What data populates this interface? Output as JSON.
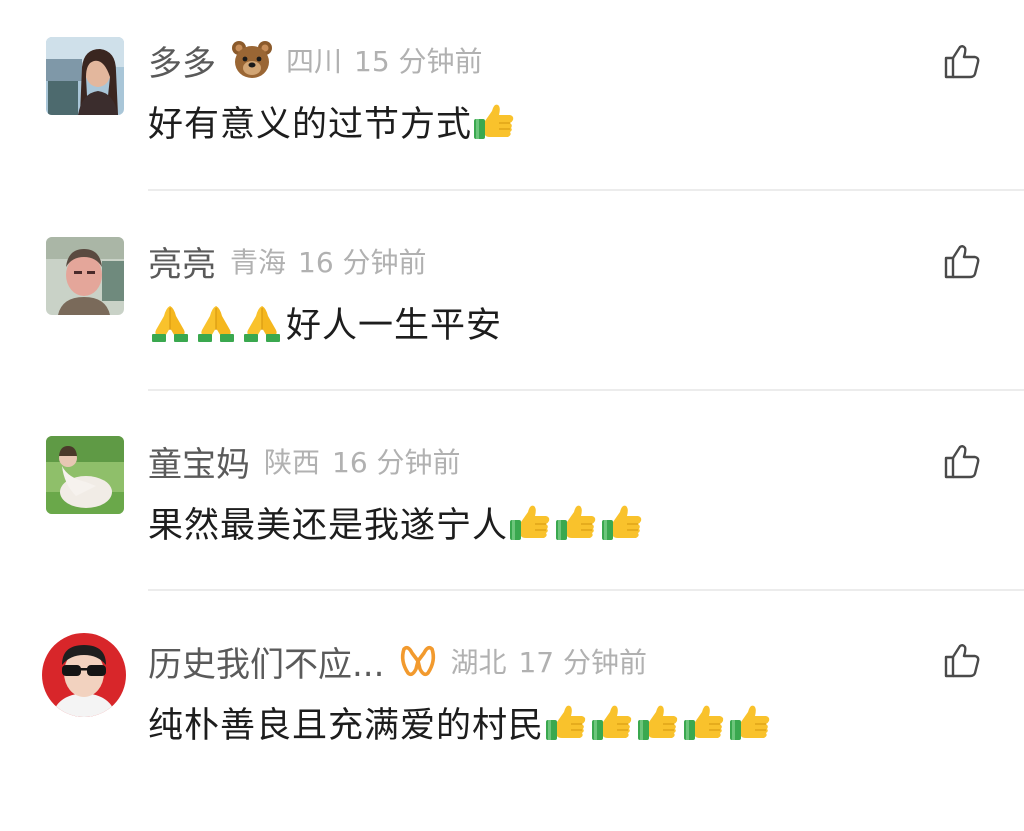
{
  "colors": {
    "username": "#5a5a5a",
    "meta": "#b1b1b1",
    "text": "#1d1d1d",
    "divider": "#ececec",
    "like_icon": "#4a4a4a",
    "emoji_yellow": "#f9c22c",
    "emoji_sleeve": "#3aa84f"
  },
  "comments": [
    {
      "username": "多多",
      "badge_icon": "bear-face-icon",
      "region": "四川",
      "time": "15 分钟前",
      "text": "好有意义的过节方式",
      "emoji_before": [],
      "emoji_after": [
        "thumbs-up-icon"
      ],
      "like_icon": "thumbs-up-outline-icon"
    },
    {
      "username": "亮亮",
      "badge_icon": "",
      "region": "青海",
      "time": "16 分钟前",
      "text": "好人一生平安",
      "emoji_before": [
        "folded-hands-icon",
        "folded-hands-icon",
        "folded-hands-icon"
      ],
      "emoji_after": [],
      "like_icon": "thumbs-up-outline-icon"
    },
    {
      "username": "童宝妈",
      "badge_icon": "",
      "region": "陕西",
      "time": "16 分钟前",
      "text": "果然最美还是我遂宁人",
      "emoji_before": [],
      "emoji_after": [
        "thumbs-up-icon",
        "thumbs-up-icon",
        "thumbs-up-icon"
      ],
      "like_icon": "thumbs-up-outline-icon"
    },
    {
      "username": "历史我们不应...",
      "badge_icon": "infinity-badge-icon",
      "region": "湖北",
      "time": "17 分钟前",
      "text": "纯朴善良且充满爱的村民",
      "emoji_before": [],
      "emoji_after": [
        "thumbs-up-icon",
        "thumbs-up-icon",
        "thumbs-up-icon",
        "thumbs-up-icon",
        "thumbs-up-icon"
      ],
      "like_icon": "thumbs-up-outline-icon"
    }
  ]
}
